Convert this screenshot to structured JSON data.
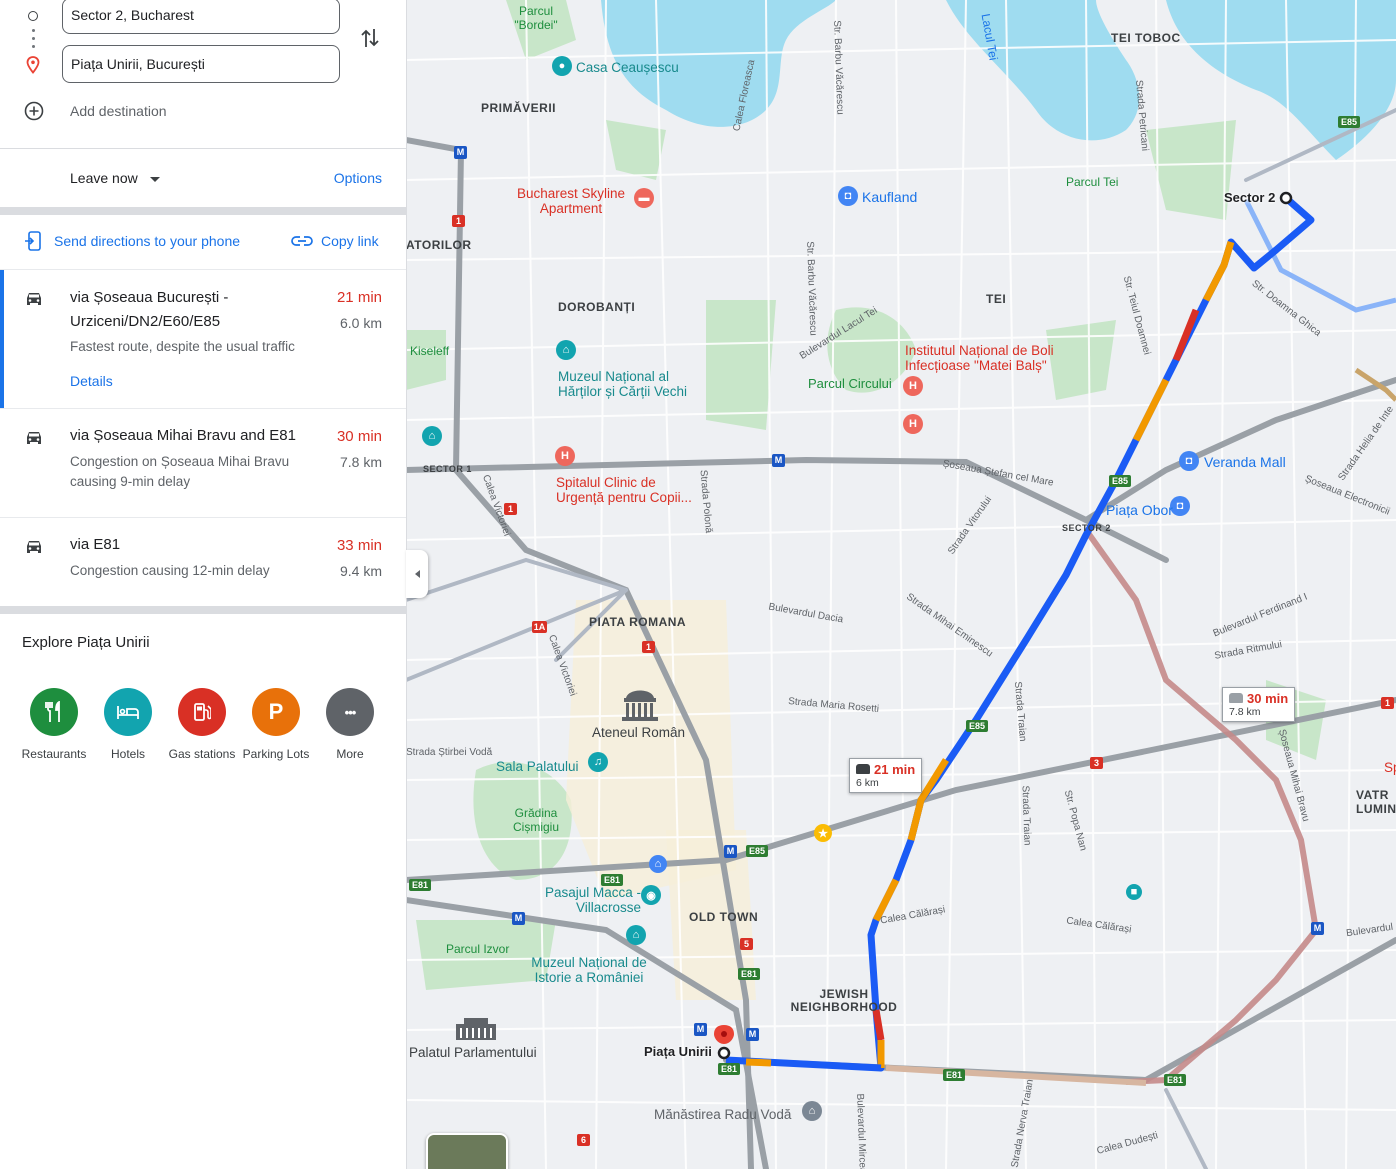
{
  "directions": {
    "origin_value": "Sector 2, Bucharest",
    "destination_value": "Piața Unirii, București",
    "add_destination": "Add destination",
    "leave_now": "Leave now",
    "options": "Options",
    "send_to_phone": "Send directions to your phone",
    "copy_link": "Copy link"
  },
  "routes": [
    {
      "title": "via Șoseaua București - Urziceni/DN2/E60/E85",
      "subtitle": "Fastest route, despite the usual traffic",
      "time": "21 min",
      "distance": "6.0 km",
      "details": "Details",
      "time_color": "#d93025"
    },
    {
      "title": "via Șoseaua Mihai Bravu and E81",
      "subtitle": "Congestion on Șoseaua Mihai Bravu causing 9-min delay",
      "time": "30 min",
      "distance": "7.8 km",
      "time_color": "#d93025"
    },
    {
      "title": "via E81",
      "subtitle": "Congestion causing 12-min delay",
      "time": "33 min",
      "distance": "9.4 km",
      "time_color": "#d93025"
    }
  ],
  "explore": {
    "title": "Explore Piața Unirii",
    "categories": [
      {
        "label": "Restaurants",
        "icon": "fork-knife-icon",
        "color": "#1e8e3e"
      },
      {
        "label": "Hotels",
        "icon": "bed-icon",
        "color": "#12a4af"
      },
      {
        "label": "Gas stations",
        "icon": "gas-pump-icon",
        "color": "#d93025"
      },
      {
        "label": "Parking Lots",
        "icon": "parking-icon",
        "color": "#e8710a",
        "glyph": "P"
      },
      {
        "label": "More",
        "icon": "more-dots-icon",
        "color": "#5f6368",
        "glyph": "•••"
      }
    ]
  },
  "map": {
    "callout_fast": {
      "time": "21 min",
      "distance": "6 km"
    },
    "callout_alt": {
      "time": "30 min",
      "distance": "7.8 km"
    },
    "origin_label": "Sector 2",
    "destination_label": "Piața Unirii",
    "areas": [
      "TEI TOBOC",
      "PRIMĂVERII",
      "DOROBANȚI",
      "TEI",
      "PIATA ROMANA",
      "OLD TOWN",
      "JEWISH NEIGHBORHOOD",
      "SECTOR 1",
      "SECTOR 2",
      "VATR LUMINO",
      "ATORILOR"
    ],
    "places_red": [
      "Bucharest Skyline Apartment",
      "Institutul Național de Boli Infecțioase \"Matei Balș\"",
      "Spitalul Clinic de Urgență pentru Copii...",
      "Sp"
    ],
    "places_teal": [
      "Casa Ceaușescu",
      "Muzeul Național al Hărților și Cărții Vechi",
      "Sala Palatului",
      "Pasajul Macca - Villacrosse",
      "Muzeul Național de Istorie a României"
    ],
    "places_green": [
      "Parcul \"Bordei\"",
      "Parcul Tei",
      "Parcul Circului",
      "Grădina Cișmigiu",
      "Parcul Izvor",
      "Lacul Tei",
      "Kiseleff"
    ],
    "shops": [
      "Kaufland",
      "Veranda Mall",
      "Piața Obor"
    ],
    "landmarks": [
      "Ateneul Român",
      "Palatul Parlamentului",
      "Mănăstirea Radu Vodă"
    ],
    "streets": [
      "Calea Floreasca",
      "Str. Barbu Văcărescu",
      "Bulevardul Lacul Tei",
      "Str. Teiul Doamnei",
      "Str. Doamna Ghica",
      "Șoseaua Ștefan cel Mare",
      "Strada Polonă",
      "Strada Vitorului",
      "Bulevardul Dacia",
      "Strada Mihai Eminescu",
      "Strada Maria Rosetti",
      "Strada Traian",
      "Str. Popa Nan",
      "Calea Călărași",
      "Șoseaua Mihai Bravu",
      "Bulevardul Ferdinand I",
      "Strada Ritmului",
      "Calea Victoriei",
      "Strada Știrbei Vodă",
      "Calea Dudești",
      "Bulevardul Mircea",
      "Strada Nerva Traian",
      "Șoseaua Electronicii",
      "Strada Helia de Inte",
      "Strada Petricani",
      "Bulevardul"
    ],
    "shields": [
      "E85",
      "E81",
      "1",
      "1A",
      "3",
      "5",
      "6"
    ]
  }
}
